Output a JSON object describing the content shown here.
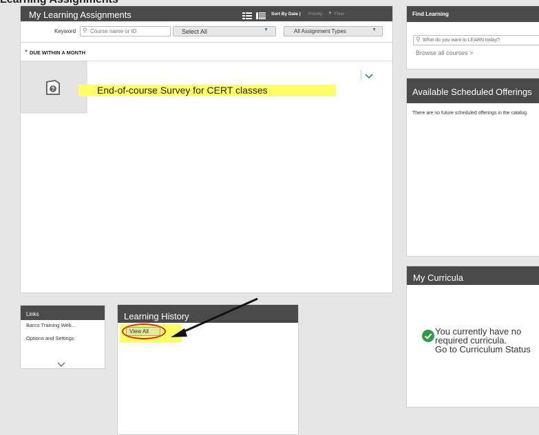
{
  "page_heading": "Learning Assignments",
  "assignments": {
    "title": "My Learning Assignments",
    "sort_label": "Sort By Date |",
    "sort_priority": "Priority",
    "filter_label": "Filter",
    "keyword_label": "Keyword",
    "keyword_placeholder": "Course name or ID",
    "select_all_value": "Select All",
    "assignment_types_value": "All Assignment Types",
    "group_label": "DUE WITHIN A MONTH",
    "item_title": "End-of-course Survey for CERT classes"
  },
  "find_learning": {
    "title": "Find Learning",
    "search_placeholder": "What do you want to LEARN today?",
    "browse_link": "Browse all courses >"
  },
  "scheduled": {
    "title": "Available Scheduled Offerings",
    "message": "There are no future scheduled offerings in the catalog."
  },
  "curricula": {
    "title": "My Curricula",
    "line1": "You currently have no",
    "line2": "required curricula.",
    "line3": "Go to Curriculum Status"
  },
  "links": {
    "title": "Links",
    "items": [
      "Barco Training Web...",
      "Options and Settings"
    ]
  },
  "history": {
    "title": "Learning History",
    "view_all": "View All"
  },
  "colors": {
    "header_bg": "#4a4a4a",
    "highlight": "#ffff66",
    "annotation_red": "#e02020",
    "success_green": "#2e9a4a",
    "link_blue": "#2a7fc1"
  }
}
